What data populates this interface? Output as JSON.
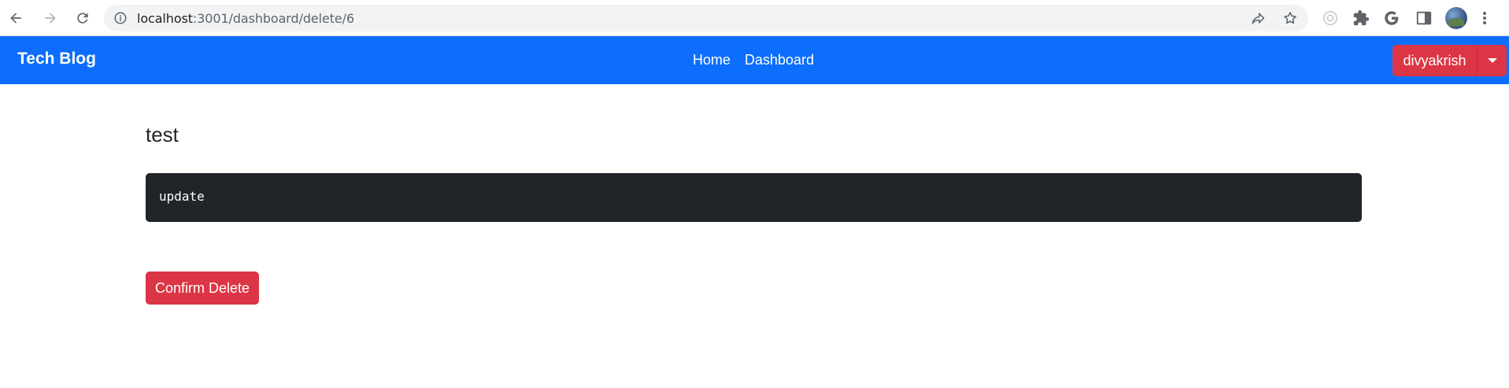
{
  "browser": {
    "url_host": "localhost",
    "url_path": ":3001/dashboard/delete/6",
    "icons": [
      "back-icon",
      "forward-icon",
      "reload-icon",
      "site-info-icon",
      "share-icon",
      "bookmark-star-icon",
      "extension-icon",
      "puzzle-icon",
      "google-icon",
      "side-panel-icon",
      "profile-avatar",
      "menu-icon"
    ]
  },
  "navbar": {
    "brand": "Tech Blog",
    "links": [
      {
        "label": "Home"
      },
      {
        "label": "Dashboard"
      }
    ],
    "user_label": "divyakrish",
    "bg_color": "#0d6efd"
  },
  "post": {
    "title": "test",
    "content": "update",
    "confirm_label": "Confirm Delete",
    "danger_color": "#dc3545"
  }
}
